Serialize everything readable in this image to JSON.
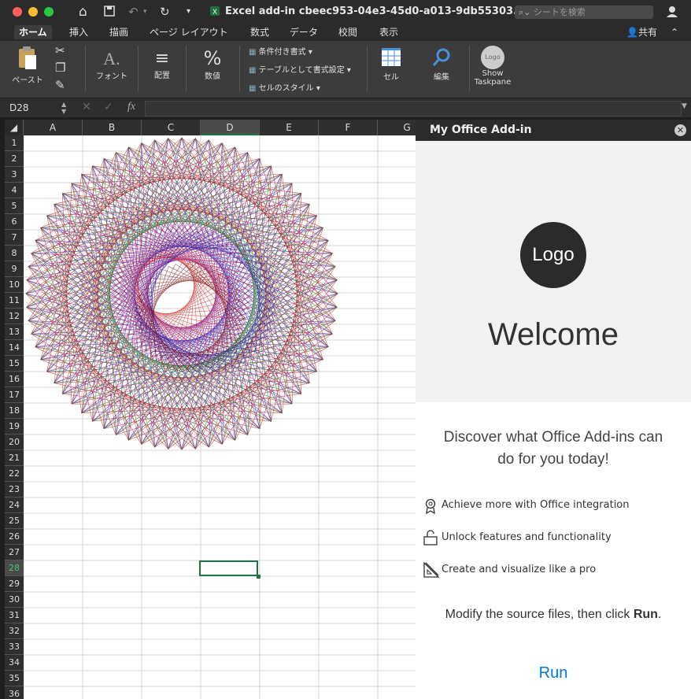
{
  "window": {
    "title": "Excel add-in cbeec953-04e3-45d0-a013-9db55303...",
    "search_placeholder": "シートを検索"
  },
  "tabs": [
    "ホーム",
    "挿入",
    "描画",
    "ページ レイアウト",
    "数式",
    "データ",
    "校閲",
    "表示"
  ],
  "share_label": "共有",
  "ribbon": {
    "paste": "ペースト",
    "font": "フォント",
    "align": "配置",
    "number": "数値",
    "cond_format": "条件付き書式",
    "table_format": "テーブルとして書式設定",
    "cell_style": "セルのスタイル",
    "cells": "セル",
    "edit": "編集",
    "show_taskpane_1": "Show",
    "show_taskpane_2": "Taskpane",
    "logo_small": "Logo"
  },
  "formula_bar": {
    "name_box": "D28",
    "fx": "fx"
  },
  "sheet": {
    "columns": [
      "A",
      "B",
      "C",
      "D",
      "E",
      "F",
      "G"
    ],
    "rows": [
      "1",
      "2",
      "3",
      "4",
      "5",
      "6",
      "7",
      "8",
      "9",
      "10",
      "11",
      "12",
      "13",
      "14",
      "15",
      "16",
      "17",
      "18",
      "19",
      "20",
      "21",
      "22",
      "23",
      "24",
      "25",
      "26",
      "27",
      "28",
      "29",
      "30",
      "31",
      "32",
      "33",
      "34",
      "35",
      "36"
    ],
    "selected_cell": "D28",
    "accent": "#217346"
  },
  "taskpane": {
    "header": "My Office Add-in",
    "logo": "Logo",
    "welcome": "Welcome",
    "discover_1": "Discover what Office Add-ins can",
    "discover_2": "do for you today!",
    "features": [
      {
        "icon": "ribbon-icon",
        "label": "Achieve more with Office integration"
      },
      {
        "icon": "unlock-icon",
        "label": "Unlock features and functionality"
      },
      {
        "icon": "design-icon",
        "label": "Create and visualize like a pro"
      }
    ],
    "modify_prefix": "Modify the source files, then click ",
    "modify_bold": "Run",
    "modify_suffix": ".",
    "run": "Run",
    "accent": "#0078d4"
  }
}
